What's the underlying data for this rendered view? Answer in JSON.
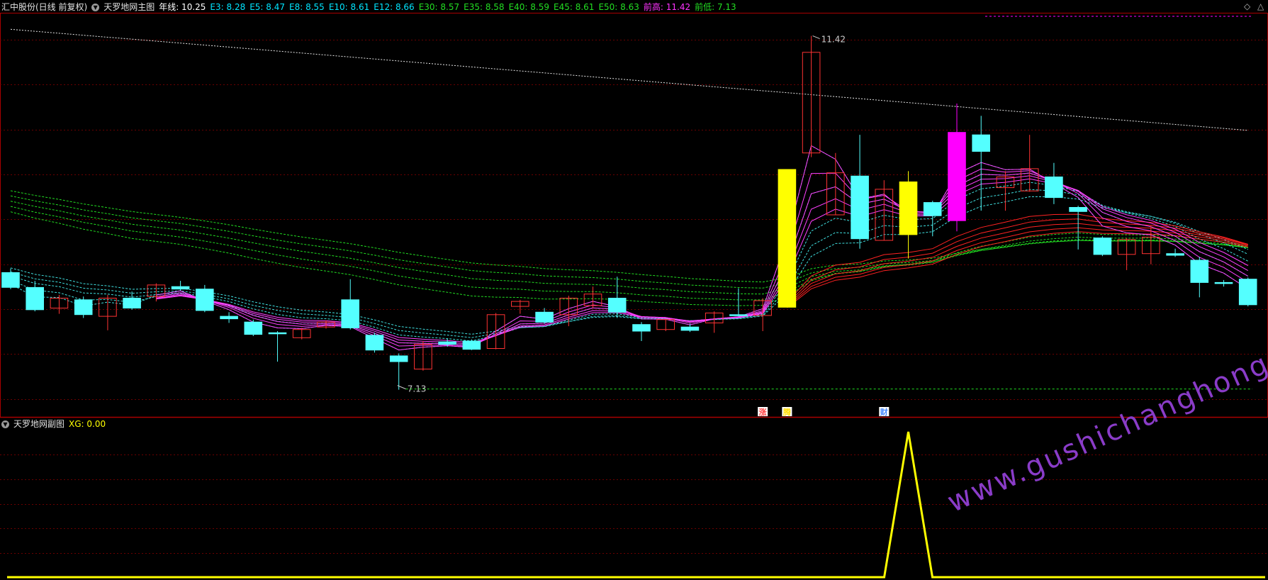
{
  "main_header": {
    "stock": "汇中股份(日线 前复权)",
    "indicator": "天罗地网主图",
    "items": [
      {
        "label": "年线: 10.25",
        "color": "#ffffff"
      },
      {
        "label": "E3: 8.28",
        "color": "#00e5ff"
      },
      {
        "label": "E5: 8.47",
        "color": "#00e5ff"
      },
      {
        "label": "E8: 8.55",
        "color": "#00e5ff"
      },
      {
        "label": "E10: 8.61",
        "color": "#00e5ff"
      },
      {
        "label": "E12: 8.66",
        "color": "#00e5ff"
      },
      {
        "label": "E30: 8.57",
        "color": "#22dd22"
      },
      {
        "label": "E35: 8.58",
        "color": "#22dd22"
      },
      {
        "label": "E40: 8.59",
        "color": "#22dd22"
      },
      {
        "label": "E45: 8.61",
        "color": "#22dd22"
      },
      {
        "label": "E50: 8.63",
        "color": "#22dd22"
      },
      {
        "label": "前高: 11.42",
        "color": "#ff33ff"
      },
      {
        "label": "前低: 7.13",
        "color": "#22dd22"
      }
    ]
  },
  "sub_header": {
    "indicator": "天罗地网副图",
    "xg_label": "XG: 0.00"
  },
  "corner_icons": {
    "left": "◇",
    "right": "△"
  },
  "watermark": "www.gushichanghong.com",
  "signals": [
    {
      "text": "涨",
      "color": "#ff4444",
      "box": "#ffffff",
      "idx": 31
    },
    {
      "text": "腾",
      "color": "#ffdd00",
      "box": "#ffffff",
      "idx": 32
    },
    {
      "text": "财",
      "color": "#4488ff",
      "box": "#ffffff",
      "idx": 36
    }
  ],
  "colors": {
    "up": "#ff3333",
    "down": "#54ffff",
    "yellow": "#ffff00",
    "magenta": "#ff00ff",
    "grid": "#6a0000",
    "border": "#aa0000",
    "annual": "#ffffff",
    "green": "#22dd22",
    "cyan": "#40e0e0",
    "pink": "#ff40ff",
    "red": "#ff2222"
  },
  "chart_data": {
    "type": "candlestick",
    "ylim": [
      6.8,
      11.7
    ],
    "prev_high": {
      "value": 11.42,
      "label": "11.42",
      "idx": 33
    },
    "prev_low": {
      "value": 7.13,
      "label": "7.13",
      "idx": 16
    },
    "candles": [
      {
        "o": 8.55,
        "c": 8.37,
        "h": 8.6,
        "l": 8.35,
        "col": "down"
      },
      {
        "o": 8.37,
        "c": 8.1,
        "h": 8.45,
        "l": 8.08,
        "col": "down"
      },
      {
        "o": 8.12,
        "c": 8.24,
        "h": 8.28,
        "l": 8.05,
        "col": "up"
      },
      {
        "o": 8.22,
        "c": 8.04,
        "h": 8.26,
        "l": 8.0,
        "col": "down"
      },
      {
        "o": 8.02,
        "c": 8.24,
        "h": 8.28,
        "l": 7.85,
        "col": "up"
      },
      {
        "o": 8.24,
        "c": 8.12,
        "h": 8.32,
        "l": 8.1,
        "col": "down"
      },
      {
        "o": 8.26,
        "c": 8.4,
        "h": 8.42,
        "l": 8.2,
        "col": "up"
      },
      {
        "o": 8.35,
        "c": 8.38,
        "h": 8.45,
        "l": 8.33,
        "col": "down"
      },
      {
        "o": 8.35,
        "c": 8.09,
        "h": 8.4,
        "l": 8.07,
        "col": "down"
      },
      {
        "o": 8.02,
        "c": 7.99,
        "h": 8.07,
        "l": 7.94,
        "col": "down"
      },
      {
        "o": 7.95,
        "c": 7.8,
        "h": 7.98,
        "l": 7.78,
        "col": "down"
      },
      {
        "o": 7.82,
        "c": 7.81,
        "h": 7.84,
        "l": 7.47,
        "col": "down"
      },
      {
        "o": 7.76,
        "c": 7.86,
        "h": 7.88,
        "l": 7.74,
        "col": "up"
      },
      {
        "o": 7.89,
        "c": 7.95,
        "h": 7.97,
        "l": 7.87,
        "col": "up"
      },
      {
        "o": 8.22,
        "c": 7.88,
        "h": 8.47,
        "l": 7.86,
        "col": "down"
      },
      {
        "o": 7.79,
        "c": 7.61,
        "h": 7.82,
        "l": 7.58,
        "col": "down"
      },
      {
        "o": 7.54,
        "c": 7.47,
        "h": 7.57,
        "l": 7.13,
        "col": "down"
      },
      {
        "o": 7.38,
        "c": 7.68,
        "h": 7.72,
        "l": 7.36,
        "col": "up"
      },
      {
        "o": 7.71,
        "c": 7.68,
        "h": 7.75,
        "l": 7.65,
        "col": "down"
      },
      {
        "o": 7.72,
        "c": 7.62,
        "h": 7.74,
        "l": 7.61,
        "col": "down"
      },
      {
        "o": 7.63,
        "c": 8.04,
        "h": 8.06,
        "l": 7.62,
        "col": "up"
      },
      {
        "o": 8.14,
        "c": 8.2,
        "h": 8.22,
        "l": 8.05,
        "col": "up"
      },
      {
        "o": 8.07,
        "c": 7.95,
        "h": 8.12,
        "l": 7.93,
        "col": "down"
      },
      {
        "o": 8.04,
        "c": 8.24,
        "h": 8.27,
        "l": 7.9,
        "col": "up"
      },
      {
        "o": 8.15,
        "c": 8.29,
        "h": 8.38,
        "l": 8.12,
        "col": "up"
      },
      {
        "o": 8.24,
        "c": 8.07,
        "h": 8.5,
        "l": 8.0,
        "col": "down"
      },
      {
        "o": 7.92,
        "c": 7.84,
        "h": 7.95,
        "l": 7.72,
        "col": "down"
      },
      {
        "o": 7.86,
        "c": 7.98,
        "h": 7.99,
        "l": 7.84,
        "col": "up"
      },
      {
        "o": 7.89,
        "c": 7.85,
        "h": 7.93,
        "l": 7.83,
        "col": "down"
      },
      {
        "o": 7.94,
        "c": 8.06,
        "h": 8.08,
        "l": 7.82,
        "col": "up"
      },
      {
        "o": 8.04,
        "c": 8.04,
        "h": 8.36,
        "l": 8.02,
        "col": "down"
      },
      {
        "o": 8.03,
        "c": 8.21,
        "h": 8.24,
        "l": 7.84,
        "col": "up"
      },
      {
        "o": 8.13,
        "c": 9.8,
        "h": 9.8,
        "l": 8.13,
        "col": "yellow"
      },
      {
        "o": 10.0,
        "c": 11.22,
        "h": 11.42,
        "l": 9.95,
        "col": "up"
      },
      {
        "o": 9.25,
        "c": 9.76,
        "h": 10.0,
        "l": 9.25,
        "col": "up"
      },
      {
        "o": 9.72,
        "c": 8.96,
        "h": 10.22,
        "l": 8.84,
        "col": "down"
      },
      {
        "o": 8.94,
        "c": 9.56,
        "h": 9.67,
        "l": 8.94,
        "col": "up"
      },
      {
        "o": 9.65,
        "c": 9.01,
        "h": 9.78,
        "l": 8.72,
        "col": "yellow"
      },
      {
        "o": 9.4,
        "c": 9.24,
        "h": 9.42,
        "l": 8.99,
        "col": "down"
      },
      {
        "o": 9.18,
        "c": 10.25,
        "h": 10.6,
        "l": 9.05,
        "col": "magenta"
      },
      {
        "o": 10.22,
        "c": 10.02,
        "h": 10.45,
        "l": 9.3,
        "col": "down"
      },
      {
        "o": 9.58,
        "c": 9.71,
        "h": 9.78,
        "l": 9.3,
        "col": "up"
      },
      {
        "o": 9.54,
        "c": 9.81,
        "h": 10.22,
        "l": 9.53,
        "col": "up"
      },
      {
        "o": 9.71,
        "c": 9.46,
        "h": 9.88,
        "l": 9.38,
        "col": "down"
      },
      {
        "o": 9.34,
        "c": 9.29,
        "h": 9.36,
        "l": 8.83,
        "col": "down"
      },
      {
        "o": 8.97,
        "c": 8.77,
        "h": 8.99,
        "l": 8.75,
        "col": "down"
      },
      {
        "o": 8.77,
        "c": 8.95,
        "h": 8.97,
        "l": 8.58,
        "col": "up"
      },
      {
        "o": 8.78,
        "c": 8.98,
        "h": 9.12,
        "l": 8.65,
        "col": "up"
      },
      {
        "o": 8.78,
        "c": 8.76,
        "h": 8.84,
        "l": 8.74,
        "col": "down"
      },
      {
        "o": 8.7,
        "c": 8.43,
        "h": 8.74,
        "l": 8.25,
        "col": "down"
      },
      {
        "o": 8.43,
        "c": 8.43,
        "h": 8.46,
        "l": 8.38,
        "col": "down"
      },
      {
        "o": 8.47,
        "c": 8.16,
        "h": 8.49,
        "l": 8.14,
        "col": "down"
      }
    ],
    "xg_peak": {
      "idx": 37,
      "value": 1,
      "label": "XG"
    }
  }
}
